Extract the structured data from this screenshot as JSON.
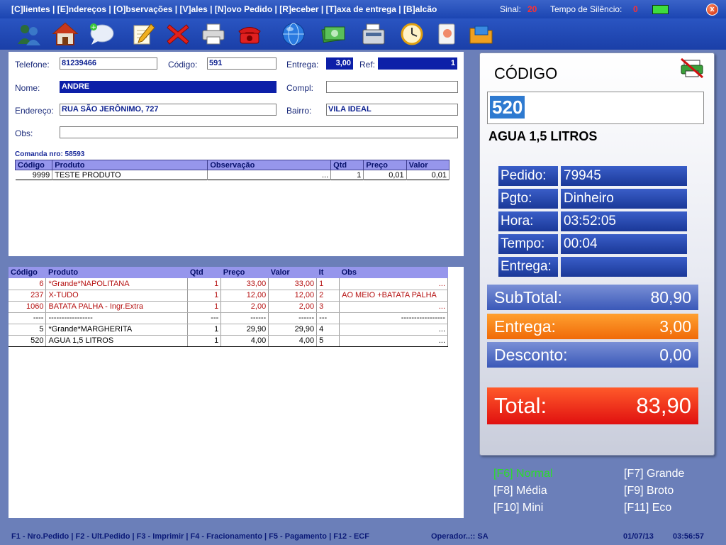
{
  "topbar": {
    "menu": "[C]lientes | [E]ndereços | [O]bservações | [V]ales | [N]ovo Pedido | [R]eceber | [T]axa de entrega | [B]alcão",
    "signal_label": "Sinal:",
    "signal_value": "20",
    "silence_label": "Tempo de Silêncio:",
    "silence_value": "0",
    "close": "x"
  },
  "toolbar": {
    "icons": [
      "users-icon",
      "house-icon",
      "chat-bubble-icon",
      "notepad-pencil-icon",
      "delete-x-icon",
      "printer-icon",
      "telephone-icon",
      "globe-icon",
      "cash-icon",
      "cash-register-icon",
      "clock-icon",
      "document-icon",
      "folder-icon"
    ]
  },
  "client": {
    "telefone_label": "Telefone:",
    "telefone": "81239466",
    "codigo_label": "Código:",
    "codigo": "591",
    "entrega_label": "Entrega:",
    "entrega": "3,00",
    "ref_label": "Ref:",
    "ref": "1",
    "nome_label": "Nome:",
    "nome": "ANDRE",
    "compl_label": "Compl:",
    "compl": "",
    "endereco_label": "Endereço:",
    "endereco": "RUA SÃO JERÔNIMO, 727",
    "bairro_label": "Bairro:",
    "bairro": "VILA IDEAL",
    "obs_label": "Obs:",
    "obs": ""
  },
  "comanda": {
    "label": "Comanda nro: 58593",
    "columns": [
      "Código",
      "Produto",
      "Observação",
      "Qtd",
      "Preço",
      "Valor"
    ],
    "rows": [
      {
        "codigo": "9999",
        "produto": "TESTE PRODUTO",
        "obs": "...",
        "qtd": "1",
        "preco": "0,01",
        "valor": "0,01"
      }
    ]
  },
  "items": {
    "columns": [
      "Código",
      "Produto",
      "Qtd",
      "Preço",
      "Valor",
      "It",
      "Obs"
    ],
    "rows": [
      {
        "codigo": "6",
        "produto": "*Grande*NAPOLITANA",
        "qtd": "1",
        "preco": "33,00",
        "valor": "33,00",
        "it": "1",
        "obs": "...",
        "color": "red"
      },
      {
        "codigo": "237",
        "produto": "X-TUDO",
        "qtd": "1",
        "preco": "12,00",
        "valor": "12,00",
        "it": "2",
        "obs": "AO MEIO +BATATA PALHA",
        "color": "red"
      },
      {
        "codigo": "1060",
        "produto": "BATATA PALHA - Ingr.Extra",
        "qtd": "1",
        "preco": "2,00",
        "valor": "2,00",
        "it": "3",
        "obs": "...",
        "color": "red"
      },
      {
        "codigo": "----",
        "produto": "-----------------",
        "qtd": "---",
        "preco": "------",
        "valor": "------",
        "it": "---",
        "obs": "-----------------",
        "color": "black"
      },
      {
        "codigo": "5",
        "produto": "*Grande*MARGHERITA",
        "qtd": "1",
        "preco": "29,90",
        "valor": "29,90",
        "it": "4",
        "obs": "...",
        "color": "black"
      },
      {
        "codigo": "520",
        "produto": "AGUA 1,5 LITROS",
        "qtd": "1",
        "preco": "4,00",
        "valor": "4,00",
        "it": "5",
        "obs": "...",
        "color": "black"
      }
    ]
  },
  "info": {
    "codigo_title": "CÓDIGO",
    "codigo_value": "520",
    "product_name": "AGUA 1,5 LITROS",
    "pedido_label": "Pedido:",
    "pedido": "79945",
    "pgto_label": "Pgto:",
    "pgto": "Dinheiro",
    "hora_label": "Hora:",
    "hora": "03:52:05",
    "tempo_label": "Tempo:",
    "tempo": "00:04",
    "entrega_label": "Entrega:",
    "entrega": ""
  },
  "totals": {
    "subtotal_label": "SubTotal:",
    "subtotal": "80,90",
    "entrega_label": "Entrega:",
    "entrega": "3,00",
    "desconto_label": "Desconto:",
    "desconto": "0,00",
    "total_label": "Total:",
    "total": "83,90"
  },
  "sizes": {
    "f6": "[F6] Normal",
    "f7": "[F7] Grande",
    "f8": "[F8] Média",
    "f9": "[F9] Broto",
    "f10": "[F10] Mini",
    "f11": "[F11] Eco"
  },
  "statusbar": {
    "shortcuts": "F1 - Nro.Pedido |  F2 - Ult.Pedido | F3 - Imprimir | F4 - Fracionamento | F5 - Pagamento | F12 - ECF",
    "operator": "Operador..:: SA",
    "date": "01/07/13",
    "time": "03:56:57"
  },
  "colors": {
    "background": "#6b7fb9",
    "titlebar": "#1b45b2",
    "accent_red": "#b51010",
    "entrega_orange": "#f06a08",
    "total_red": "#e01010",
    "active_green": "#2bdc2b"
  }
}
